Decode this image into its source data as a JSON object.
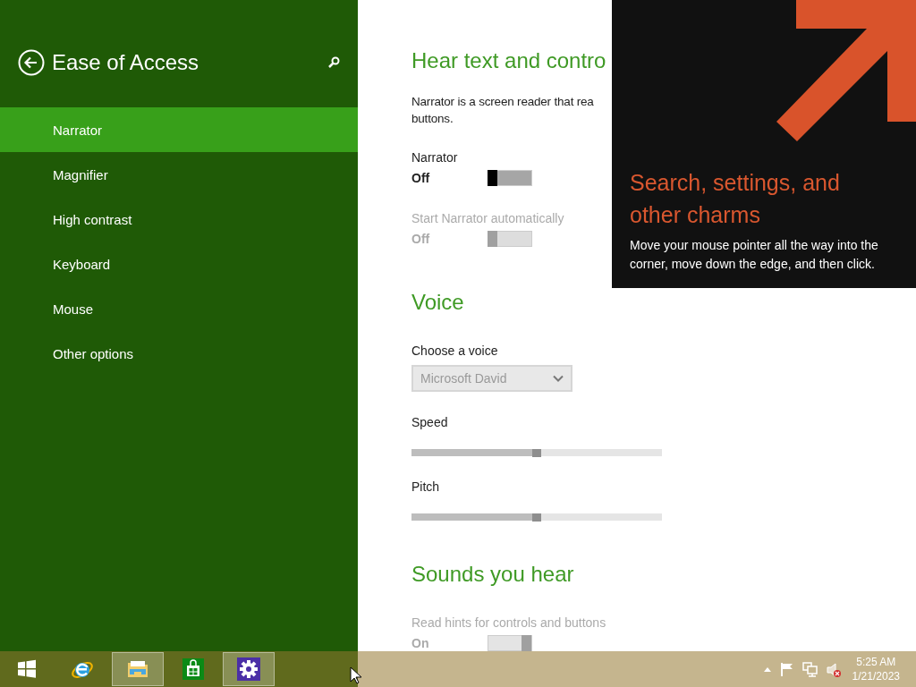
{
  "nav": {
    "title": "Ease of Access",
    "items": [
      {
        "label": "Narrator",
        "selected": true
      },
      {
        "label": "Magnifier",
        "selected": false
      },
      {
        "label": "High contrast",
        "selected": false
      },
      {
        "label": "Keyboard",
        "selected": false
      },
      {
        "label": "Mouse",
        "selected": false
      },
      {
        "label": "Other options",
        "selected": false
      }
    ]
  },
  "sections": [
    {
      "heading": "Hear text and contro",
      "description_lines": [
        "Narrator is a screen reader that rea",
        "buttons."
      ],
      "settings": [
        {
          "kind": "toggle",
          "label": "Narrator",
          "state_text": "Off",
          "on": false,
          "disabled": false
        },
        {
          "kind": "toggle",
          "label": "Start Narrator automatically",
          "state_text": "Off",
          "on": false,
          "disabled": true
        }
      ]
    },
    {
      "heading": "Voice",
      "settings": [
        {
          "kind": "dropdown",
          "label": "Choose a voice",
          "value": "Microsoft David",
          "disabled": true
        },
        {
          "kind": "slider",
          "label": "Speed",
          "level": 0.5
        },
        {
          "kind": "slider",
          "label": "Pitch",
          "level": 0.5
        }
      ]
    },
    {
      "heading": "Sounds you hear",
      "settings": [
        {
          "kind": "toggle",
          "label": "Read hints for controls and buttons",
          "state_text": "On",
          "on": true,
          "disabled": true
        }
      ]
    }
  ],
  "tip": {
    "title": "Search, settings, and other charms",
    "text": "Move your mouse pointer all the way into the corner, move down the edge, and then click."
  },
  "taskbar": {
    "buttons": [
      {
        "kind": "start",
        "running": false
      },
      {
        "kind": "browser",
        "running": false
      },
      {
        "kind": "folder",
        "running": true
      },
      {
        "kind": "store",
        "running": false
      },
      {
        "kind": "settings",
        "running": true
      }
    ],
    "clock": {
      "time": "5:25 AM",
      "date": "1/21/2023"
    }
  }
}
